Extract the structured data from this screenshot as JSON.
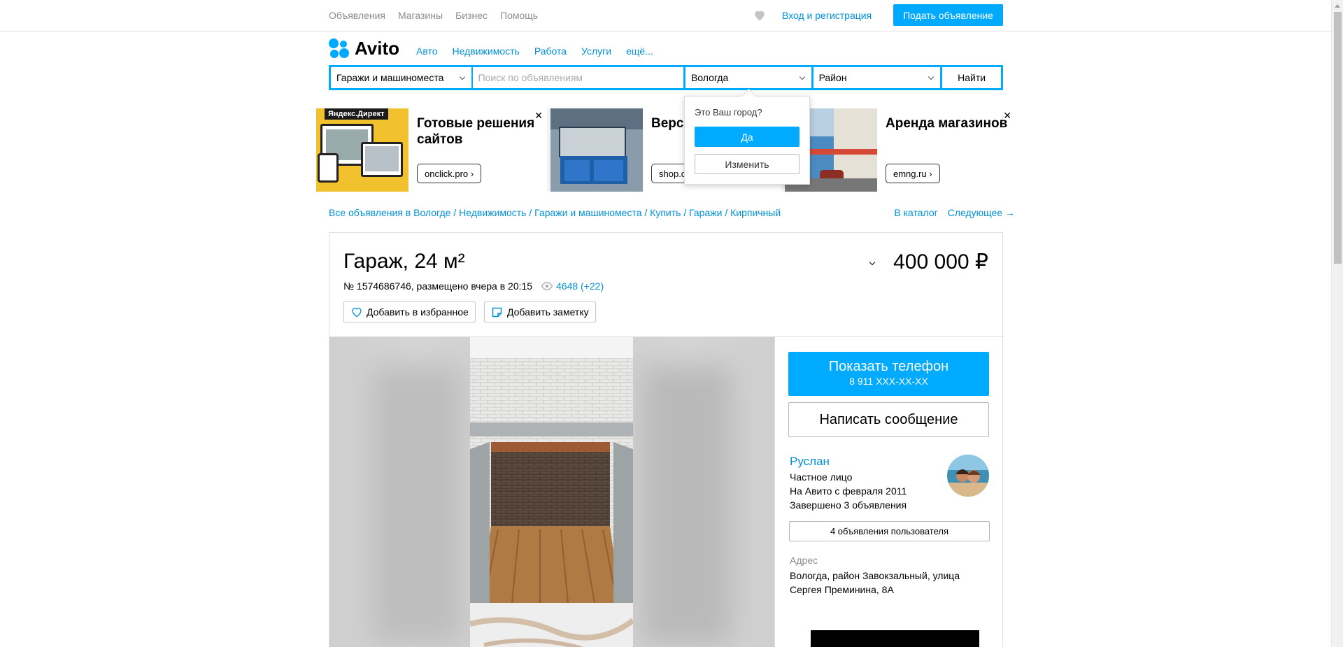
{
  "topbar": {
    "links": [
      "Объявления",
      "Магазины",
      "Бизнес",
      "Помощь"
    ],
    "login": "Вход и регистрация",
    "post_button": "Подать объявление"
  },
  "logo": {
    "word": "Avito",
    "colors": [
      "#00aaff",
      "#97cf26",
      "#ff6163",
      "#a169f7"
    ]
  },
  "catnav": [
    "Авто",
    "Недвижимость",
    "Работа",
    "Услуги",
    "ещё..."
  ],
  "search": {
    "category": "Гаражи и машиноместа",
    "placeholder": "Поиск по объявлениям",
    "city": "Вологда",
    "district": "Район",
    "find": "Найти"
  },
  "ads": [
    {
      "badge": "Яндекс.Директ",
      "title": "Готовые решения сайтов",
      "link": "onclick.pro ›"
    },
    {
      "title": "Верст слеса",
      "link": "shop.c"
    },
    {
      "title": "Аренда магазинов",
      "link": "emng.ru ›"
    }
  ],
  "city_popup": {
    "question": "Это Ваш город?",
    "yes": "Да",
    "change": "Изменить"
  },
  "breadcrumbs": "Все объявления в Вологде / Недвижимость / Гаражи и машиноместа / Купить / Гаражи / Кирпичный",
  "nav_right": {
    "catalog": "В каталог",
    "next": "Следующее →"
  },
  "listing": {
    "title": "Гараж, 24 м²",
    "price": "400 000 ₽",
    "meta": "№ 1574686746, размещено вчера в 20:15",
    "views": "4648 (+22)",
    "fav_button": "Добавить в избранное",
    "note_button": "Добавить заметку"
  },
  "contact": {
    "show_phone": "Показать телефон",
    "phone_mask": "8 911 XXX-XX-XX",
    "write_message": "Написать сообщение"
  },
  "seller": {
    "name": "Руслан",
    "type": "Частное лицо",
    "since": "На Авито с февраля 2011",
    "completed": "Завершено 3 объявления",
    "ads_count": "4 объявления пользователя"
  },
  "address": {
    "label": "Адрес",
    "value": "Вологда, район Завокзальный, улица Сергея Преминина, 8А"
  },
  "colors": {
    "accent": "#00aaff",
    "link": "#0091d9"
  }
}
